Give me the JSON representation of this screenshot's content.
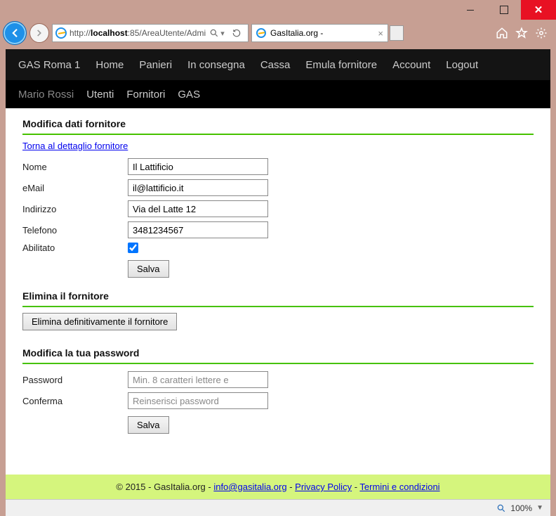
{
  "window": {
    "url_prefix": "http://",
    "url_host": "localhost",
    "url_rest": ":85/AreaUtente/Admi",
    "tab_title": "GasItalia.org -"
  },
  "nav1": {
    "brand": "GAS Roma 1",
    "items": [
      "Home",
      "Panieri",
      "In consegna",
      "Cassa",
      "Emula fornitore",
      "Account",
      "Logout"
    ]
  },
  "nav2": {
    "user": "Mario Rossi",
    "items": [
      "Utenti",
      "Fornitori",
      "GAS"
    ]
  },
  "section_edit": {
    "title": "Modifica dati fornitore",
    "back_link": "Torna al dettaglio fornitore",
    "labels": {
      "nome": "Nome",
      "email": "eMail",
      "indirizzo": "Indirizzo",
      "telefono": "Telefono",
      "abilitato": "Abilitato"
    },
    "values": {
      "nome": "Il Lattificio",
      "email": "il@lattificio.it",
      "indirizzo": "Via del Latte 12",
      "telefono": "3481234567",
      "abilitato": true
    },
    "save_label": "Salva"
  },
  "section_delete": {
    "title": "Elimina il fornitore",
    "button": "Elimina definitivamente il fornitore"
  },
  "section_pwd": {
    "title": "Modifica la tua password",
    "labels": {
      "password": "Password",
      "conferma": "Conferma"
    },
    "placeholders": {
      "password": "Min. 8 caratteri lettere e",
      "conferma": "Reinserisci password"
    },
    "save_label": "Salva"
  },
  "footer": {
    "copyright": "© 2015 - GasItalia.org - ",
    "email": "info@gasitalia.org",
    "sep": " - ",
    "privacy": "Privacy Policy",
    "terms": "Termini e condizioni"
  },
  "status": {
    "zoom": "100%"
  }
}
